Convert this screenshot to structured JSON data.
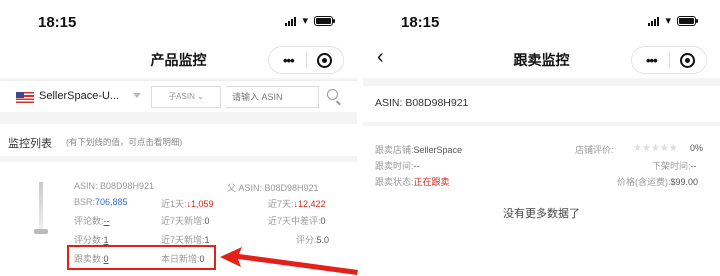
{
  "left_screen": {
    "status": {
      "time": "18:15"
    },
    "nav": {
      "title": "产品监控"
    },
    "search": {
      "store": "SellerSpace-U...",
      "asin_select": "子ASIN ⌄",
      "input_placeholder": "请输入 ASIN"
    },
    "list": {
      "title": "监控列表",
      "hint": "(有下划线的值，可点击看明细)"
    },
    "item": {
      "asin": "ASIN: B08D98H921",
      "parent_asin": "父 ASIN: B08D98H921",
      "bsr_label": "BSR:",
      "bsr_value": "706,885",
      "d1_label": "近1天:",
      "d1_value": "↓1,059",
      "d7_label": "近7天:",
      "d7_value": "↓12,422",
      "reviews": "评论数:",
      "reviews_value": "--",
      "new_reviews_7d": "近7天新增:",
      "new_reviews_7d_value": "0",
      "neg_reviews_7d": "近7天中差评:",
      "neg_reviews_7d_value": "0",
      "ratings": "评分数:",
      "ratings_value": "1",
      "new_ratings_7d": "近7天新增:",
      "new_ratings_7d_value": "1",
      "score": "评分:",
      "score_value": "5.0",
      "sellers": "跟卖数:",
      "sellers_value": "0",
      "today_new": "本日新增:",
      "today_new_value": "0"
    }
  },
  "right_screen": {
    "status": {
      "time": "18:15"
    },
    "nav": {
      "title": "跟卖监控"
    },
    "asin": "ASIN: B08D98H921",
    "detail": {
      "store_label": "跟卖店铺:",
      "store_value": "SellerSpace",
      "rating_label": "店铺评价:",
      "rating_value": "0%",
      "time_label": "跟卖时间:",
      "time_value": "--",
      "offline_label": "下架时间:",
      "offline_value": "--",
      "state_label": "跟卖状态:",
      "state_value": "正在跟卖",
      "price_label": "价格(含运费):",
      "price_value": "$99.00"
    },
    "no_more": "没有更多数据了"
  },
  "colors": {
    "accent_blue": "#2d6fd1",
    "alert_red": "#d8281c",
    "highlight_red": "#e3211a"
  }
}
